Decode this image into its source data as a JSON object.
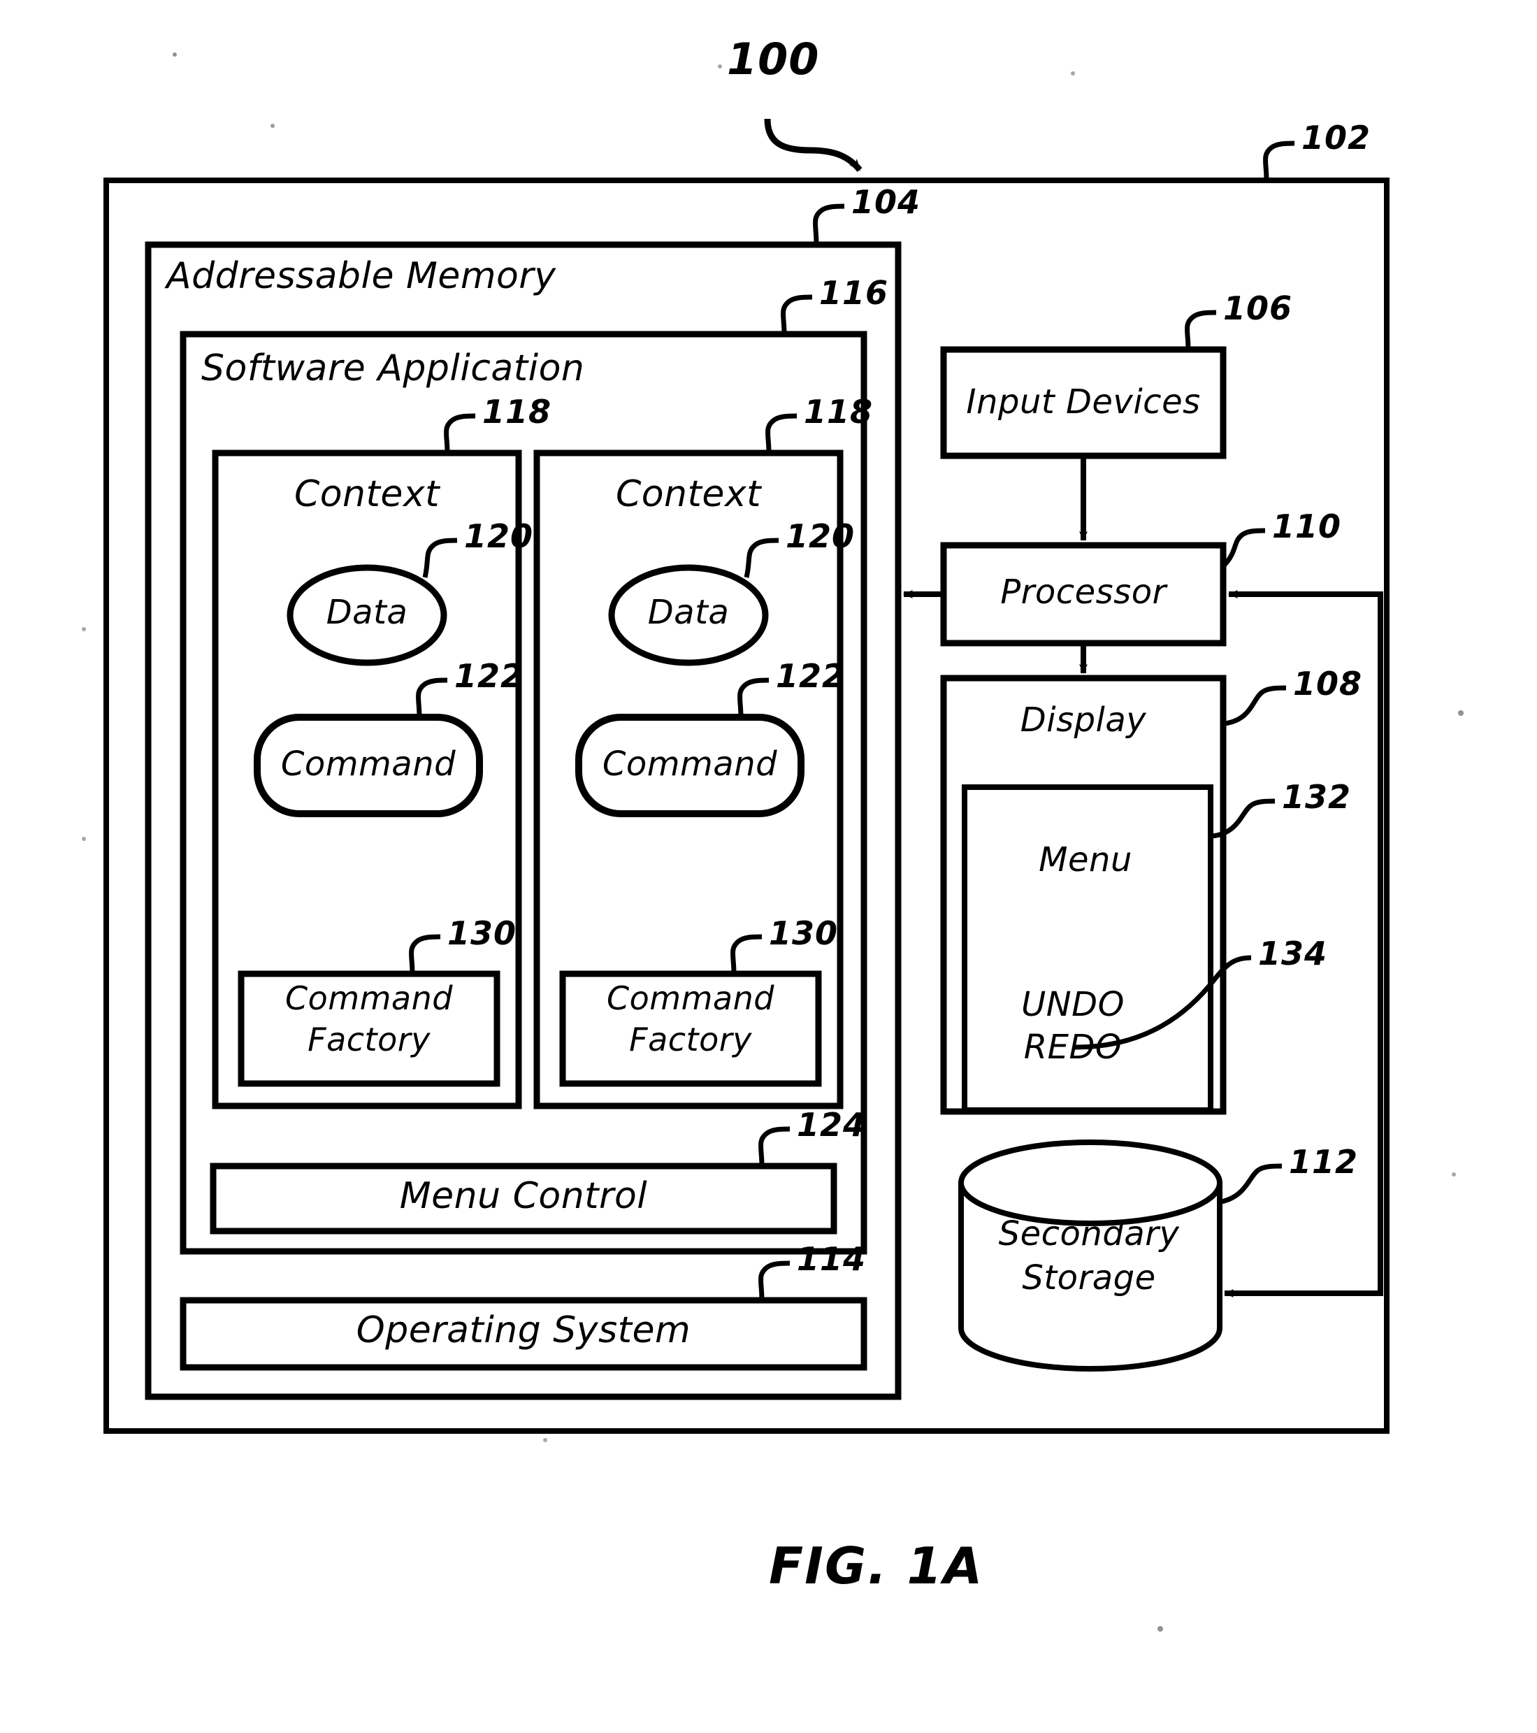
{
  "figure": {
    "caption": "FIG. 1A",
    "system_ref": "100"
  },
  "refs": {
    "system": "100",
    "computer": "102",
    "addressable_memory": "104",
    "input_devices": "106",
    "display": "108",
    "processor": "110",
    "secondary_storage": "112",
    "operating_system": "114",
    "software_application": "116",
    "context": "118",
    "data": "120",
    "command": "122",
    "menu_control": "124",
    "command_factory": "130",
    "menu": "132",
    "undo_redo": "134"
  },
  "blocks": {
    "addressable_memory": {
      "label": "Addressable Memory",
      "ref": "104"
    },
    "software_application": {
      "label": "Software Application",
      "ref": "116"
    },
    "menu_control": {
      "label": "Menu Control",
      "ref": "124"
    },
    "operating_system": {
      "label": "Operating System",
      "ref": "114"
    },
    "input_devices": {
      "label": "Input Devices",
      "ref": "106"
    },
    "processor": {
      "label": "Processor",
      "ref": "110"
    },
    "display": {
      "label": "Display",
      "ref": "108"
    },
    "menu": {
      "label": "Menu",
      "ref": "132"
    },
    "undo": {
      "label": "UNDO",
      "ref": "134"
    },
    "redo": {
      "label": "REDO",
      "ref": "134"
    },
    "secondary_storage_line1": {
      "label": "Secondary",
      "ref": "112"
    },
    "secondary_storage_line2": {
      "label": "Storage",
      "ref": "112"
    }
  },
  "contexts": [
    {
      "title": "Context",
      "title_ref": "118",
      "data": {
        "label": "Data",
        "ref": "120"
      },
      "command": {
        "label": "Command",
        "ref": "122"
      },
      "factory_line1": "Command",
      "factory_line2": "Factory",
      "factory_ref": "130"
    },
    {
      "title": "Context",
      "title_ref": "118",
      "data": {
        "label": "Data",
        "ref": "120"
      },
      "command": {
        "label": "Command",
        "ref": "122"
      },
      "factory_line1": "Command",
      "factory_line2": "Factory",
      "factory_ref": "130"
    }
  ],
  "colors": {
    "ink": "#000000",
    "paper": "#ffffff"
  }
}
